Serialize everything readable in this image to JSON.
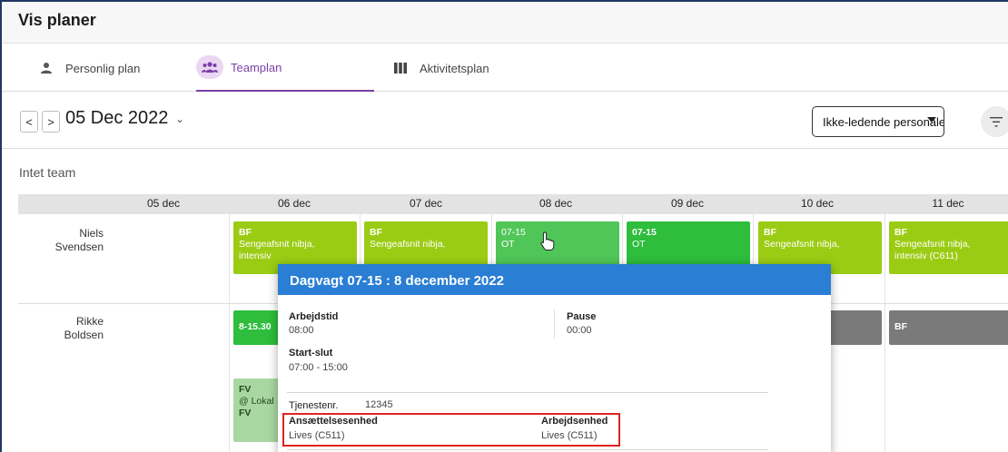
{
  "header": {
    "title": "Vis planer"
  },
  "tabs": [
    {
      "label": "Personlig plan",
      "icon": "person-icon"
    },
    {
      "label": "Teamplan",
      "icon": "team-icon",
      "active": true
    },
    {
      "label": "Aktivitetsplan",
      "icon": "columns-icon"
    }
  ],
  "toolbar": {
    "prev": "<",
    "next": ">",
    "date": "05 Dec 2022",
    "date_caret": "⌄",
    "select_value": "Ikke-ledende personale p",
    "filter_icon": "filter-icon"
  },
  "team_label": "Intet team",
  "days": [
    "05 dec",
    "06 dec",
    "07 dec",
    "08 dec",
    "09 dec",
    "10 dec",
    "11 dec"
  ],
  "people": [
    {
      "name_line1": "Niels",
      "name_line2": "Svendsen"
    },
    {
      "name_line1": "Rikke",
      "name_line2": "Boldsen"
    }
  ],
  "shifts": {
    "niels_06": {
      "code": "BF",
      "desc1": "Sengeafsnit nibja,",
      "desc2": "intensiv"
    },
    "niels_07": {
      "code": "BF",
      "desc1": "Sengeafsnit nibja,"
    },
    "niels_08": {
      "code": "07-15",
      "desc1": "OT"
    },
    "niels_09": {
      "code": "07-15",
      "desc1": "OT"
    },
    "niels_10": {
      "code": "BF",
      "desc1": "Sengeafsnit nibja,"
    },
    "niels_11": {
      "code": "BF",
      "desc1": "Sengeafsnit nibja,",
      "desc2": "intensiv (C611)"
    },
    "rikke_06a": {
      "code": "8-15.30"
    },
    "rikke_06b": {
      "code": "FV",
      "desc1": "@ Lokal",
      "code2": "FV"
    },
    "rikke_11": {
      "code": "BF"
    }
  },
  "popup": {
    "title": "Dagvagt 07-15 : 8 december 2022",
    "arbejdstid_label": "Arbejdstid",
    "arbejdstid_value": "08:00",
    "pause_label": "Pause",
    "pause_value": "00:00",
    "startslut_label": "Start-slut",
    "startslut_value": "07:00 - 15:00",
    "tjenestenr_label": "Tjenestenr.",
    "tjenestenr_value": "12345",
    "ansaettelse_label": "Ansættelsesenhed",
    "ansaettelse_value": "Lives (C511)",
    "arbejdsenhed_label": "Arbejdsenhed",
    "arbejdsenhed_value": "Lives (C511)"
  },
  "colors": {
    "accent_purple": "#7b3fa8",
    "popup_blue": "#2a7ed3",
    "shift_lime": "#9bcc14",
    "shift_green": "#2ebd3d",
    "shift_gray": "#7a7a7a",
    "highlight_red": "#e02222"
  }
}
